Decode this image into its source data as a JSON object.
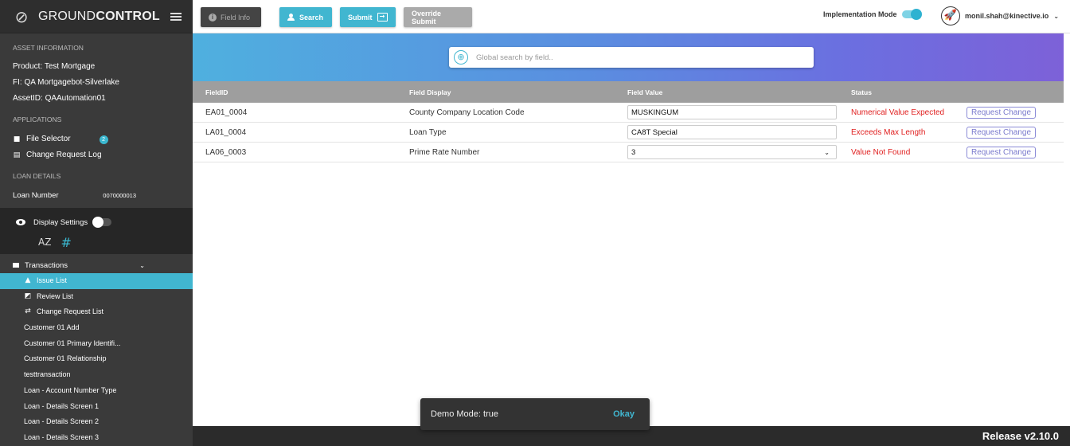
{
  "brand": {
    "prefix": "GROUND",
    "suffix": "CONTROL"
  },
  "asset_info": {
    "section_title": "ASSET INFORMATION",
    "product": "Product:  Test Mortgage",
    "fi": "FI:  QA Mortgagebot-Silverlake",
    "asset_id": "AssetID:  QAAutomation01"
  },
  "applications": {
    "section_title": "APPLICATIONS",
    "file_selector": "File Selector",
    "file_selector_badge": "2",
    "change_request_log": "Change Request Log"
  },
  "loan_details": {
    "section_title": "LOAN DETAILS",
    "label": "Loan Number",
    "value": "0070000013"
  },
  "display_settings": {
    "label": "Display Settings",
    "sort_az": "AZ",
    "sort_hash": "#"
  },
  "transactions": {
    "label": "Transactions",
    "items": [
      {
        "label": "Issue List",
        "icon": "warning-icon"
      },
      {
        "label": "Review List",
        "icon": "review-icon"
      },
      {
        "label": "Change Request List",
        "icon": "compare-icon"
      }
    ],
    "screens": [
      "Customer 01 Add",
      "Customer 01 Primary Identifi...",
      "Customer 01 Relationship",
      "testtransaction",
      "Loan - Account Number Type",
      "Loan - Details Screen 1",
      "Loan - Details Screen 2",
      "Loan - Details Screen 3"
    ]
  },
  "toolbar": {
    "field_info": "Field Info",
    "search": "Search",
    "submit": "Submit",
    "override_submit": "Override Submit",
    "implementation_mode": "Implementation Mode",
    "user_email": "monil.shah@kinective.io"
  },
  "global_search": {
    "placeholder": "Global search by field.."
  },
  "table": {
    "headers": [
      "FieldID",
      "Field Display",
      "Field Value",
      "Status"
    ],
    "rows": [
      {
        "field_id": "EA01_0004",
        "display": "County Company Location Code",
        "value": "MUSKINGUM",
        "status": "Numerical Value Expected",
        "action": "Request Change"
      },
      {
        "field_id": "LA01_0004",
        "display": "Loan Type",
        "value": "CA8T Special",
        "status": "Exceeds Max Length",
        "action": "Request Change"
      },
      {
        "field_id": "LA06_0003",
        "display": "Prime Rate Number",
        "value": "3",
        "status": "Value Not Found",
        "action": "Request Change"
      }
    ]
  },
  "snackbar": {
    "message": "Demo Mode: true",
    "action": "Okay"
  },
  "footer": {
    "release": "Release v2.10.0"
  },
  "colors": {
    "accent": "#41b6d0",
    "status_error": "#e02020",
    "sidebar_bg": "#3a3a3a"
  }
}
